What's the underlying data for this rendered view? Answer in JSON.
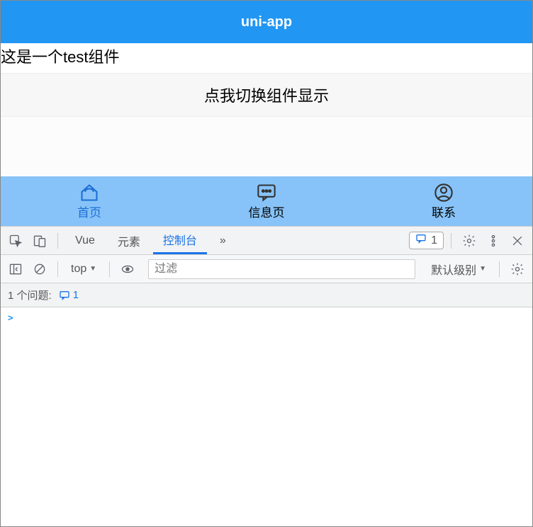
{
  "app": {
    "title": "uni-app",
    "component_text": "这是一个test组件",
    "toggle_btn": "点我切换组件显示",
    "tabs": [
      {
        "label": "首页"
      },
      {
        "label": "信息页"
      },
      {
        "label": "联系"
      }
    ]
  },
  "devtools": {
    "tabs": {
      "vue": "Vue",
      "elements": "元素",
      "console": "控制台"
    },
    "chevron": "»",
    "messages_count": "1",
    "context_selector": "top",
    "filter_placeholder": "过滤",
    "level_selector": "默认级别",
    "issues_label": "1 个问题:",
    "issues_count": "1",
    "prompt": ">"
  }
}
